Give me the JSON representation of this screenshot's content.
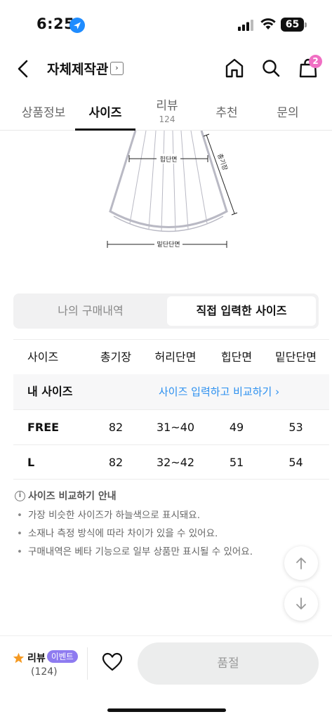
{
  "status_bar": {
    "time": "6:25",
    "battery": "65"
  },
  "header": {
    "shop_name": "자체제작관",
    "cart_count": "2"
  },
  "tabs": [
    {
      "label": "상품정보"
    },
    {
      "label": "사이즈"
    },
    {
      "label": "리뷰",
      "count": "124"
    },
    {
      "label": "추천"
    },
    {
      "label": "문의"
    }
  ],
  "illustration": {
    "hip_label": "힙단면",
    "length_label": "총기장",
    "hem_label": "밑단단면"
  },
  "segment": {
    "left": "나의 구매내역",
    "right": "직접 입력한 사이즈"
  },
  "size_table": {
    "headers": [
      "사이즈",
      "총기장",
      "허리단면",
      "힙단면",
      "밑단단면"
    ],
    "my_size_label": "내 사이즈",
    "compare_link": "사이즈 입력하고 비교하기 ›",
    "rows": [
      [
        "FREE",
        "82",
        "31~40",
        "49",
        "53"
      ],
      [
        "L",
        "82",
        "32~42",
        "51",
        "54"
      ]
    ]
  },
  "guide": {
    "title": "사이즈 비교하기 안내",
    "items": [
      "가장 비슷한 사이즈가 하늘색으로 표시돼요.",
      "소재나 측정 방식에 따라 차이가 있을 수 있어요.",
      "구매내역은 베타 기능으로 일부 상품만 표시될 수 있어요."
    ]
  },
  "bottom_bar": {
    "review_label": "리뷰",
    "event_badge": "이벤트",
    "review_count": "(124)",
    "sold_out": "품절"
  },
  "colors": {
    "accent_link": "#2a8ff0",
    "badge_pink": "#f06ec3",
    "event_purple": "#8e7bf0",
    "star": "#f59a23"
  }
}
